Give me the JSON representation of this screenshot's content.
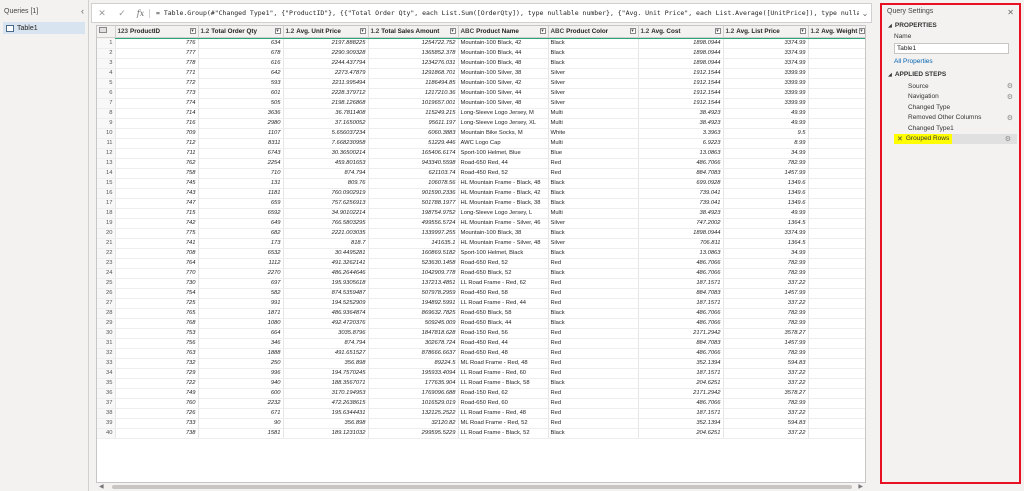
{
  "queries": {
    "header": "Queries [1]",
    "items": [
      "Table1"
    ]
  },
  "formula": {
    "text": "= Table.Group(#\"Changed Type1\", {\"ProductID\"}, {{\"Total Order Qty\", each List.Sum([OrderQty]), type nullable number}, {\"Avg. Unit Price\", each List.Average([UnitPrice]), type nullable number},"
  },
  "grid": {
    "columns": [
      {
        "type": "123",
        "name": "ProductID",
        "align": "num"
      },
      {
        "type": "1.2",
        "name": "Total Order Qty",
        "align": "num"
      },
      {
        "type": "1.2",
        "name": "Avg. Unit Price",
        "align": "num"
      },
      {
        "type": "1.2",
        "name": "Total Sales Amount",
        "align": "num"
      },
      {
        "type": "ABC",
        "name": "Product Name",
        "align": "txt"
      },
      {
        "type": "ABC",
        "name": "Product Color",
        "align": "txt"
      },
      {
        "type": "1.2",
        "name": "Avg. Cost",
        "align": "num"
      },
      {
        "type": "1.2",
        "name": "Avg. List Price",
        "align": "num"
      },
      {
        "type": "1.2",
        "name": "Avg. Weight",
        "align": "num"
      }
    ],
    "rows": [
      [
        "776",
        "634",
        "2197.888225",
        "1254722.752",
        "Mountain-100 Black, 42",
        "Black",
        "1898.0944",
        "3374.99",
        ""
      ],
      [
        "777",
        "678",
        "2290.909328",
        "1365852.378",
        "Mountain-100 Black, 44",
        "Black",
        "1898.0944",
        "3374.99",
        ""
      ],
      [
        "778",
        "616",
        "2244.437794",
        "1234276.031",
        "Mountain-100 Black, 48",
        "Black",
        "1898.0944",
        "3374.99",
        ""
      ],
      [
        "771",
        "642",
        "2273.47879",
        "1291868.701",
        "Mountain-100 Silver, 38",
        "Silver",
        "1912.1544",
        "3399.99",
        ""
      ],
      [
        "772",
        "593",
        "2211.995494",
        "1186494.85",
        "Mountain-100 Silver, 42",
        "Silver",
        "1912.1544",
        "3399.99",
        ""
      ],
      [
        "773",
        "601",
        "2228.379712",
        "1217210.36",
        "Mountain-100 Silver, 44",
        "Silver",
        "1912.1544",
        "3399.99",
        ""
      ],
      [
        "774",
        "505",
        "2198.126868",
        "1019657.001",
        "Mountain-100 Silver, 48",
        "Silver",
        "1912.1544",
        "3399.99",
        ""
      ],
      [
        "714",
        "3636",
        "36.7811408",
        "115249.215",
        "Long-Sleeve Logo Jersey, M",
        "Multi",
        "38.4923",
        "49.99",
        ""
      ],
      [
        "716",
        "2980",
        "37.1650052",
        "95611.197",
        "Long-Sleeve Logo Jersey, XL",
        "Multi",
        "38.4923",
        "49.99",
        ""
      ],
      [
        "709",
        "1107",
        "5.656037234",
        "6060.3883",
        "Mountain Bike Socks, M",
        "White",
        "3.3963",
        "9.5",
        ""
      ],
      [
        "712",
        "8311",
        "7.668230958",
        "51229.446",
        "AWC Logo Cap",
        "Multi",
        "6.9223",
        "8.99",
        ""
      ],
      [
        "711",
        "6743",
        "30.36500214",
        "165406.6174",
        "Sport-100 Helmet, Blue",
        "Blue",
        "13.0863",
        "34.99",
        ""
      ],
      [
        "762",
        "2254",
        "459.801653",
        "943340.5598",
        "Road-650 Red, 44",
        "Red",
        "486.7066",
        "782.99",
        ""
      ],
      [
        "758",
        "710",
        "874.794",
        "621103.74",
        "Road-450 Red, 52",
        "Red",
        "884.7083",
        "1457.99",
        ""
      ],
      [
        "745",
        "131",
        "809.76",
        "106078.56",
        "HL Mountain Frame - Black, 48",
        "Black",
        "699.0928",
        "1349.6",
        ""
      ],
      [
        "743",
        "1181",
        "760.0902919",
        "901590.2336",
        "HL Mountain Frame - Black, 42",
        "Black",
        "739.041",
        "1349.6",
        ""
      ],
      [
        "747",
        "659",
        "757.6256913",
        "501788.1977",
        "HL Mountain Frame - Black, 38",
        "Black",
        "739.041",
        "1349.6",
        ""
      ],
      [
        "715",
        "6592",
        "34.90102214",
        "198754.9752",
        "Long-Sleeve Logo Jersey, L",
        "Multi",
        "38.4923",
        "49.99",
        ""
      ],
      [
        "742",
        "649",
        "766.5803295",
        "499556.5724",
        "HL Mountain Frame - Silver, 46",
        "Silver",
        "747.2002",
        "1364.5",
        ""
      ],
      [
        "775",
        "682",
        "2221.003035",
        "1339997.255",
        "Mountain-100 Black, 38",
        "Black",
        "1898.0944",
        "3374.99",
        ""
      ],
      [
        "741",
        "173",
        "818.7",
        "141635.1",
        "HL Mountain Frame - Silver, 48",
        "Silver",
        "706.811",
        "1364.5",
        ""
      ],
      [
        "708",
        "6532",
        "30.4495281",
        "160869.5182",
        "Sport-100 Helmet, Black",
        "Black",
        "13.0863",
        "34.99",
        ""
      ],
      [
        "764",
        "1112",
        "491.3262141",
        "523630.1458",
        "Road-650 Red, 52",
        "Red",
        "486.7066",
        "782.99",
        ""
      ],
      [
        "770",
        "2270",
        "486.2644646",
        "1042909.778",
        "Road-650 Black, 52",
        "Black",
        "486.7066",
        "782.99",
        ""
      ],
      [
        "730",
        "697",
        "195.9305618",
        "137213.4851",
        "LL Road Frame - Red, 62",
        "Red",
        "187.1571",
        "337.22",
        ""
      ],
      [
        "754",
        "582",
        "874.5359487",
        "507978.2959",
        "Road-450 Red, 58",
        "Red",
        "884.7083",
        "1457.99",
        ""
      ],
      [
        "725",
        "991",
        "194.5252909",
        "194892.5991",
        "LL Road Frame - Red, 44",
        "Red",
        "187.1571",
        "337.22",
        ""
      ],
      [
        "765",
        "1871",
        "486.9364874",
        "869632.7825",
        "Road-650 Black, 58",
        "Black",
        "486.7066",
        "782.99",
        ""
      ],
      [
        "768",
        "1080",
        "492.4720376",
        "509245.009",
        "Road-650 Black, 44",
        "Black",
        "486.7066",
        "782.99",
        ""
      ],
      [
        "753",
        "664",
        "3035.8796",
        "1847818.628",
        "Road-150 Red, 56",
        "Red",
        "2171.2942",
        "3578.27",
        ""
      ],
      [
        "756",
        "346",
        "874.794",
        "302678.724",
        "Road-450 Red, 44",
        "Red",
        "884.7083",
        "1457.99",
        ""
      ],
      [
        "763",
        "1888",
        "491.651527",
        "878666.6637",
        "Road-650 Red, 48",
        "Red",
        "486.7066",
        "782.99",
        ""
      ],
      [
        "732",
        "250",
        "356.898",
        "89224.5",
        "ML Road Frame - Red, 48",
        "Red",
        "352.1394",
        "594.83",
        ""
      ],
      [
        "729",
        "996",
        "194.7570245",
        "195933.4094",
        "LL Road Frame - Red, 60",
        "Red",
        "187.1571",
        "337.22",
        ""
      ],
      [
        "722",
        "940",
        "188.3567071",
        "177635.904",
        "LL Road Frame - Black, 58",
        "Black",
        "204.6251",
        "337.22",
        ""
      ],
      [
        "749",
        "600",
        "3170.194953",
        "1769096.688",
        "Road-150 Red, 62",
        "Red",
        "2171.2942",
        "3578.27",
        ""
      ],
      [
        "760",
        "2232",
        "472.2638615",
        "1016529.019",
        "Road-650 Red, 60",
        "Red",
        "486.7066",
        "782.99",
        ""
      ],
      [
        "726",
        "671",
        "195.6344431",
        "132125.2522",
        "LL Road Frame - Red, 48",
        "Red",
        "187.1571",
        "337.22",
        ""
      ],
      [
        "733",
        "90",
        "356.898",
        "32120.82",
        "ML Road Frame - Red, 52",
        "Red",
        "352.1394",
        "594.83",
        ""
      ],
      [
        "738",
        "1581",
        "189.1231032",
        "299595.5229",
        "LL Road Frame - Black, 52",
        "Black",
        "204.6251",
        "337.22",
        ""
      ]
    ]
  },
  "settings": {
    "title": "Query Settings",
    "properties_label": "PROPERTIES",
    "name_label": "Name",
    "name_value": "Table1",
    "all_properties": "All Properties",
    "steps_label": "APPLIED STEPS",
    "steps": [
      {
        "label": "Source",
        "gear": true
      },
      {
        "label": "Navigation",
        "gear": true
      },
      {
        "label": "Changed Type",
        "gear": false
      },
      {
        "label": "Removed Other Columns",
        "gear": true
      },
      {
        "label": "Changed Type1",
        "gear": false
      },
      {
        "label": "Grouped Rows",
        "gear": true,
        "active": true
      }
    ]
  }
}
